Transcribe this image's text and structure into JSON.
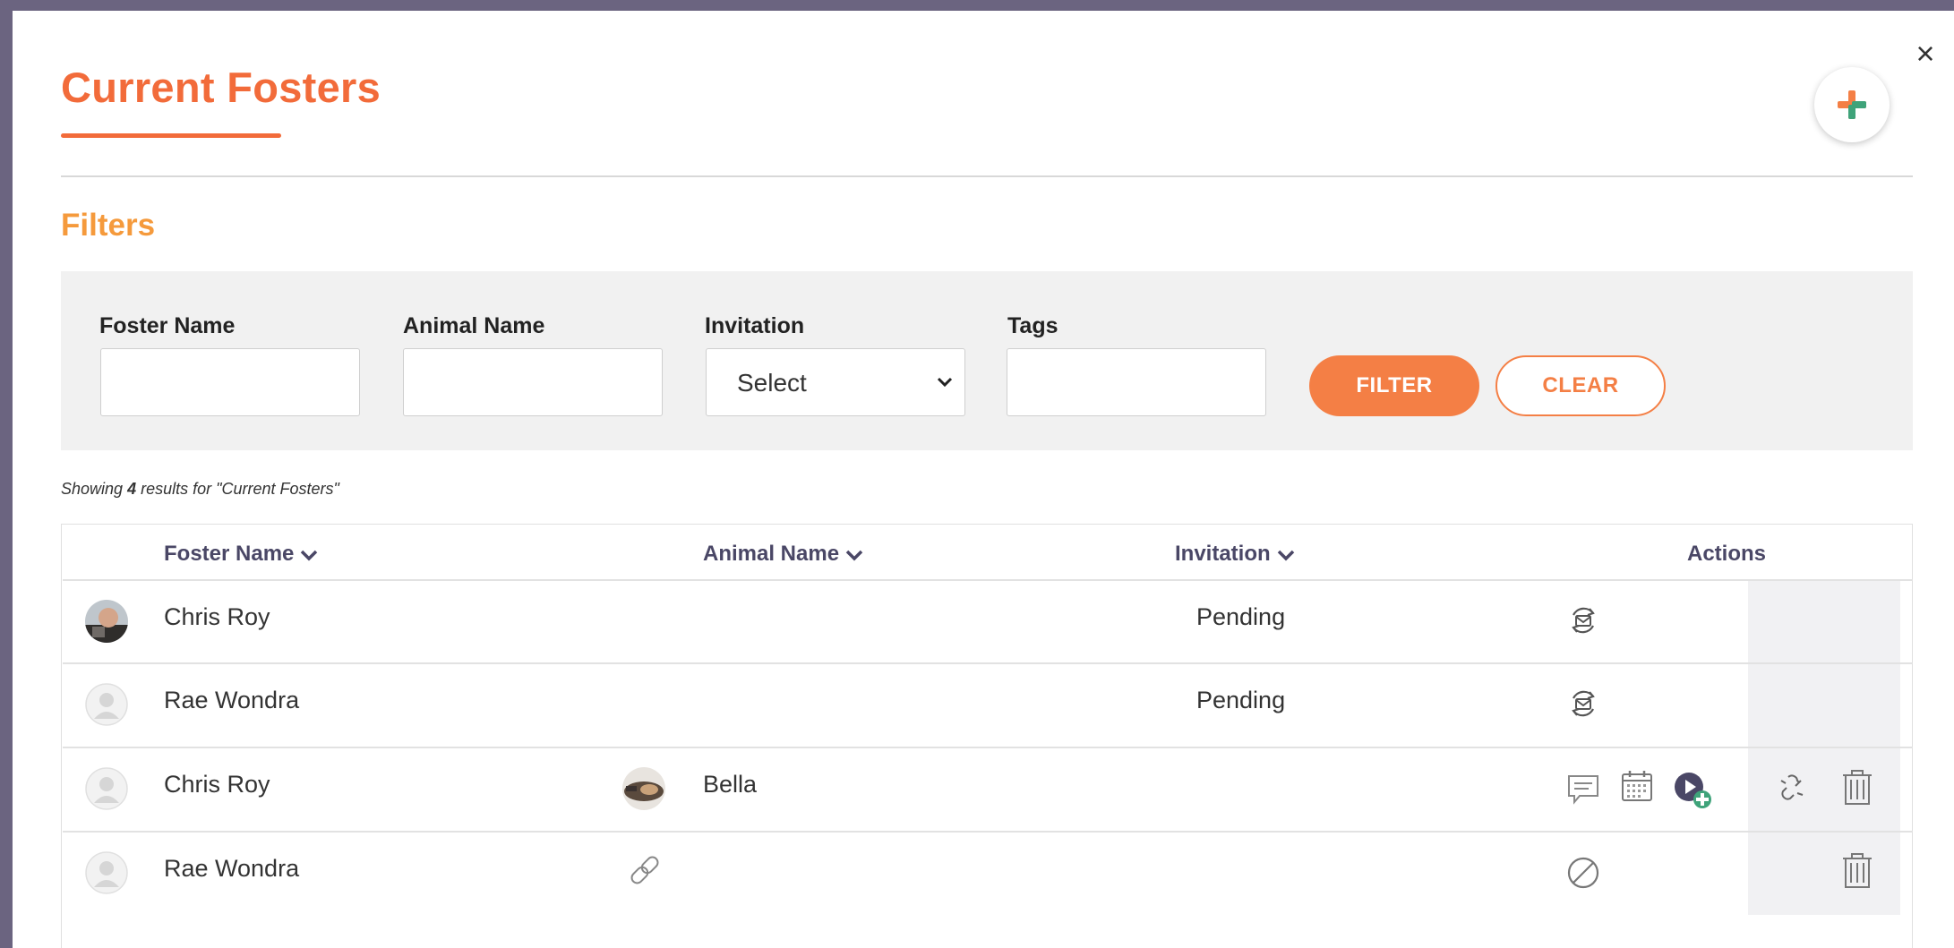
{
  "modal": {
    "title": "Current Fosters",
    "close_symbol": "×",
    "add_icon": "plus-icon",
    "colors": {
      "accent": "#f26b3a",
      "filters_title": "#f59a3c",
      "plus_orange": "#f47f45",
      "plus_green": "#3fa37a"
    }
  },
  "filters": {
    "title": "Filters",
    "foster_name_label": "Foster Name",
    "animal_name_label": "Animal Name",
    "invitation_label": "Invitation",
    "invitation_value": "Select",
    "tags_label": "Tags",
    "filter_button": "FILTER",
    "clear_button": "CLEAR"
  },
  "results": {
    "prefix": "Showing ",
    "count": "4",
    "suffix": " results for \"Current Fosters\""
  },
  "table": {
    "headers": {
      "foster_name": "Foster Name",
      "animal_name": "Animal Name",
      "invitation": "Invitation",
      "actions": "Actions"
    },
    "rows": [
      {
        "foster_name": "Chris Roy",
        "animal_name": "",
        "invitation": "Pending",
        "actions": [
          "resend-invite-icon"
        ]
      },
      {
        "foster_name": "Rae Wondra",
        "animal_name": "",
        "invitation": "Pending",
        "actions": [
          "resend-invite-icon"
        ]
      },
      {
        "foster_name": "Chris Roy",
        "animal_name": "Bella",
        "invitation": "",
        "actions": [
          "message-icon",
          "calendar-icon",
          "video-add-icon",
          "unlink-icon",
          "trash-icon"
        ]
      },
      {
        "foster_name": "Rae Wondra",
        "animal_name": "",
        "invitation": "",
        "actions": [
          "link-icon",
          "disabled-icon",
          "trash-icon"
        ]
      }
    ]
  }
}
